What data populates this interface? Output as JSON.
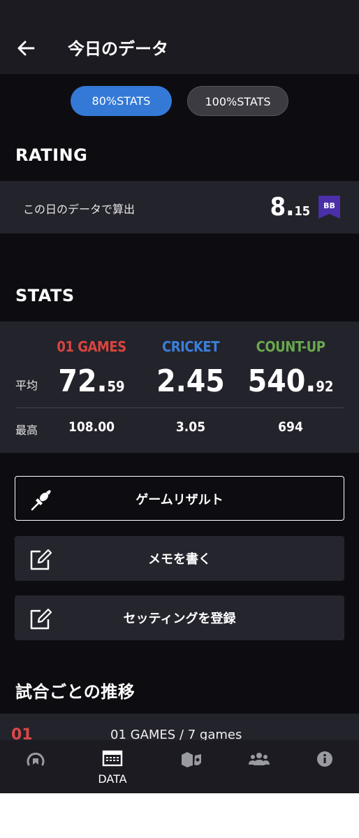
{
  "header": {
    "title": "今日のデータ",
    "back_icon": "arrow-left-icon"
  },
  "tabs": [
    {
      "label": "80%STATS",
      "active": true
    },
    {
      "label": "100%STATS",
      "active": false
    }
  ],
  "rating": {
    "heading": "RATING",
    "label": "この日のデータで算出",
    "value_int": "8.",
    "value_dec": "15",
    "badge": "BB",
    "badge_color": "#4a2fa8"
  },
  "stats": {
    "heading": "STATS",
    "row_avg": "平均",
    "row_max": "最高",
    "columns": [
      {
        "name": "01 GAMES",
        "color": "#d9453f",
        "avg_int": "72.",
        "avg_dec": "59",
        "max": "108.00"
      },
      {
        "name": "CRICKET",
        "color": "#3a7fd9",
        "avg_int": "2.45",
        "avg_dec": "",
        "max": "3.05"
      },
      {
        "name": "COUNT-UP",
        "color": "#6aa84f",
        "avg_int": "540.",
        "avg_dec": "92",
        "max": "694"
      }
    ]
  },
  "actions": [
    {
      "label": "ゲームリザルト",
      "icon": "dart-icon"
    },
    {
      "label": "メモを書く",
      "icon": "edit-icon"
    },
    {
      "label": "セッティングを登録",
      "icon": "edit-icon"
    }
  ],
  "trend": {
    "heading": "試合ごとの推移",
    "tag": "01",
    "text": "01 GAMES / 7 games"
  },
  "nav": {
    "items": [
      {
        "icon": "rating-gauge-icon",
        "label": ""
      },
      {
        "icon": "calendar-icon",
        "label": "DATA"
      },
      {
        "icon": "awards-icon",
        "label": ""
      },
      {
        "icon": "friends-icon",
        "label": ""
      },
      {
        "icon": "info-icon",
        "label": ""
      }
    ]
  }
}
